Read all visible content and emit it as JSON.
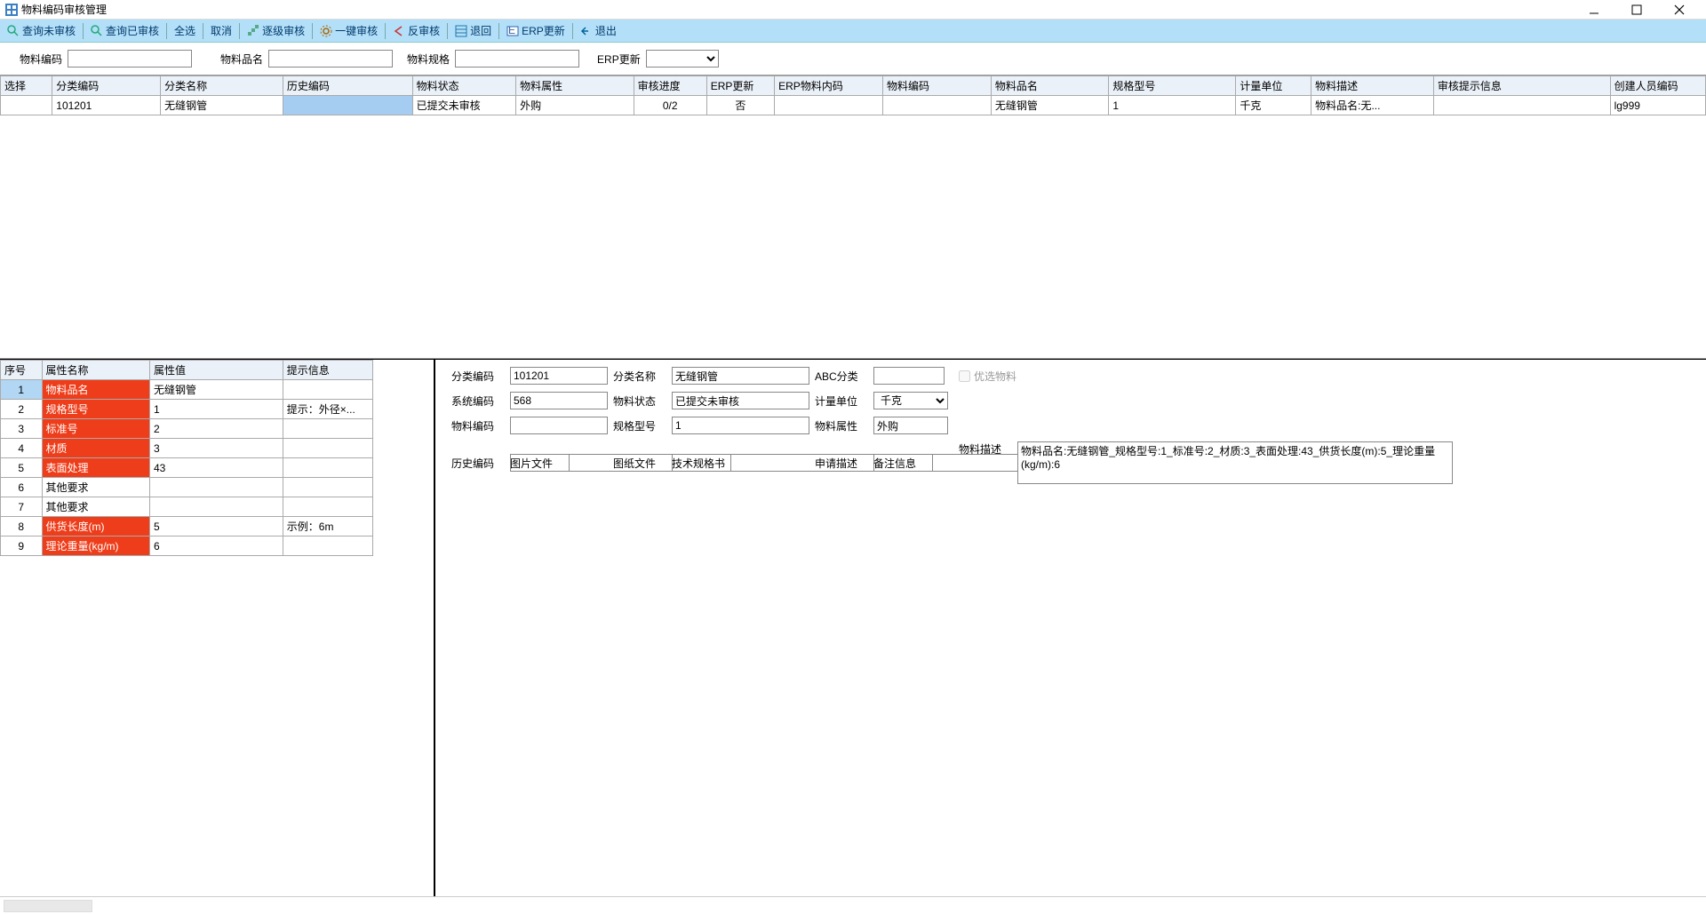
{
  "window": {
    "title": "物料编码审核管理"
  },
  "toolbar": [
    {
      "icon": "search",
      "label": "查询未审核"
    },
    {
      "icon": "search",
      "label": "查询已审核"
    },
    {
      "icon": null,
      "label": "全选"
    },
    {
      "icon": null,
      "label": "取消"
    },
    {
      "icon": "step",
      "label": "逐级审核"
    },
    {
      "icon": "gear",
      "label": "一键审核"
    },
    {
      "icon": "back",
      "label": "反审核"
    },
    {
      "icon": "grid",
      "label": "退回"
    },
    {
      "icon": "erp",
      "label": "ERP更新"
    },
    {
      "icon": "exit",
      "label": "退出"
    }
  ],
  "filters": {
    "material_code_label": "物料编码",
    "material_name_label": "物料品名",
    "material_spec_label": "物料规格",
    "erp_update_label": "ERP更新",
    "material_code": "",
    "material_name": "",
    "material_spec": "",
    "erp_update": ""
  },
  "main_table": {
    "columns": [
      "选择",
      "分类编码",
      "分类名称",
      "历史编码",
      "物料状态",
      "物料属性",
      "审核进度",
      "ERP更新",
      "ERP物料内码",
      "物料编码",
      "物料品名",
      "规格型号",
      "计量单位",
      "物料描述",
      "审核提示信息",
      "创建人员编码"
    ],
    "widths": [
      44,
      92,
      104,
      110,
      88,
      100,
      62,
      50,
      92,
      92,
      100,
      108,
      64,
      104,
      150,
      70
    ],
    "rows": [
      {
        "cells": [
          "",
          "101201",
          "无缝钢管",
          "",
          "已提交未审核",
          "外购",
          "0/2",
          "否",
          "",
          "",
          "无缝钢管",
          "1",
          "千克",
          "物料品名:无...",
          "",
          "lg999"
        ],
        "highlight_index": 3
      }
    ]
  },
  "attr_table": {
    "columns": [
      "序号",
      "属性名称",
      "属性值",
      "提示信息"
    ],
    "rows": [
      {
        "idx": "1",
        "name": "物料品名",
        "value": "无缝钢管",
        "hint": "",
        "red": true,
        "sel": true
      },
      {
        "idx": "2",
        "name": "规格型号",
        "value": "1",
        "hint": "提示：外径×...",
        "red": true
      },
      {
        "idx": "3",
        "name": "标准号",
        "value": "2",
        "hint": "",
        "red": true
      },
      {
        "idx": "4",
        "name": "材质",
        "value": "3",
        "hint": "",
        "red": true
      },
      {
        "idx": "5",
        "name": "表面处理",
        "value": "43",
        "hint": "",
        "red": true
      },
      {
        "idx": "6",
        "name": "其他要求",
        "value": "",
        "hint": "",
        "red": false
      },
      {
        "idx": "7",
        "name": "其他要求",
        "value": "",
        "hint": "",
        "red": false
      },
      {
        "idx": "8",
        "name": "供货长度(m)",
        "value": "5",
        "hint": "示例：6m",
        "red": true
      },
      {
        "idx": "9",
        "name": "理论重量(kg/m)",
        "value": "6",
        "hint": "",
        "red": true
      }
    ]
  },
  "detail": {
    "labels": {
      "cat_code": "分类编码",
      "cat_name": "分类名称",
      "abc": "ABC分类",
      "preferred": "优选物料",
      "sys_code": "系统编码",
      "status": "物料状态",
      "unit": "计量单位",
      "mat_code": "物料编码",
      "spec": "规格型号",
      "attr": "物料属性",
      "hist_code": "历史编码",
      "image_file": "图片文件",
      "drawing_file": "图纸文件",
      "tech_spec": "技术规格书",
      "apply_desc": "申请描述",
      "remark": "备注信息",
      "mat_desc": "物料描述"
    },
    "values": {
      "cat_code": "101201",
      "cat_name": "无缝钢管",
      "abc": "",
      "sys_code": "568",
      "status": "已提交未审核",
      "unit": "千克",
      "mat_code": "",
      "spec": "1",
      "attr": "外购",
      "hist_code": "",
      "image_file": "",
      "drawing_file": "",
      "tech_spec": "",
      "apply_desc": "",
      "remark": "",
      "mat_desc": "物料品名:无缝钢管_规格型号:1_标准号:2_材质:3_表面处理:43_供货长度(m):5_理论重量(kg/m):6"
    }
  }
}
